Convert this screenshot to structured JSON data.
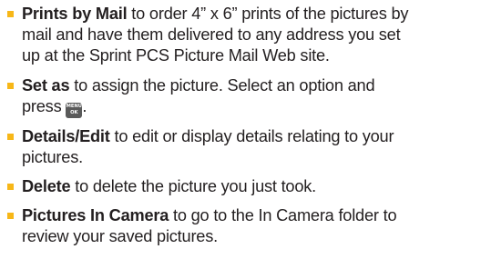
{
  "items": [
    {
      "term": "Prints by Mail",
      "lines": [
        " to order 4” x 6” prints of the pictures by",
        "mail and have them delivered to any address you set",
        "up at the Sprint PCS Picture Mail Web site."
      ]
    },
    {
      "term": "Set as",
      "lines": [
        " to assign the picture. Select an option and",
        "press "
      ],
      "tail": "."
    },
    {
      "term": "Details/Edit",
      "lines": [
        " to edit or display details relating to your",
        "pictures."
      ]
    },
    {
      "term": "Delete",
      "lines": [
        " to delete the picture you just took."
      ]
    },
    {
      "term": "Pictures In Camera",
      "lines": [
        " to go to the In Camera folder to",
        "review your saved pictures."
      ]
    }
  ],
  "menu_ok_key": {
    "top": "MENU",
    "bottom": "OK",
    "icon": "menu-ok-key-icon"
  },
  "colors": {
    "bullet": "#f7b718",
    "text": "#231f20",
    "key_bg": "#5a5a5a"
  }
}
